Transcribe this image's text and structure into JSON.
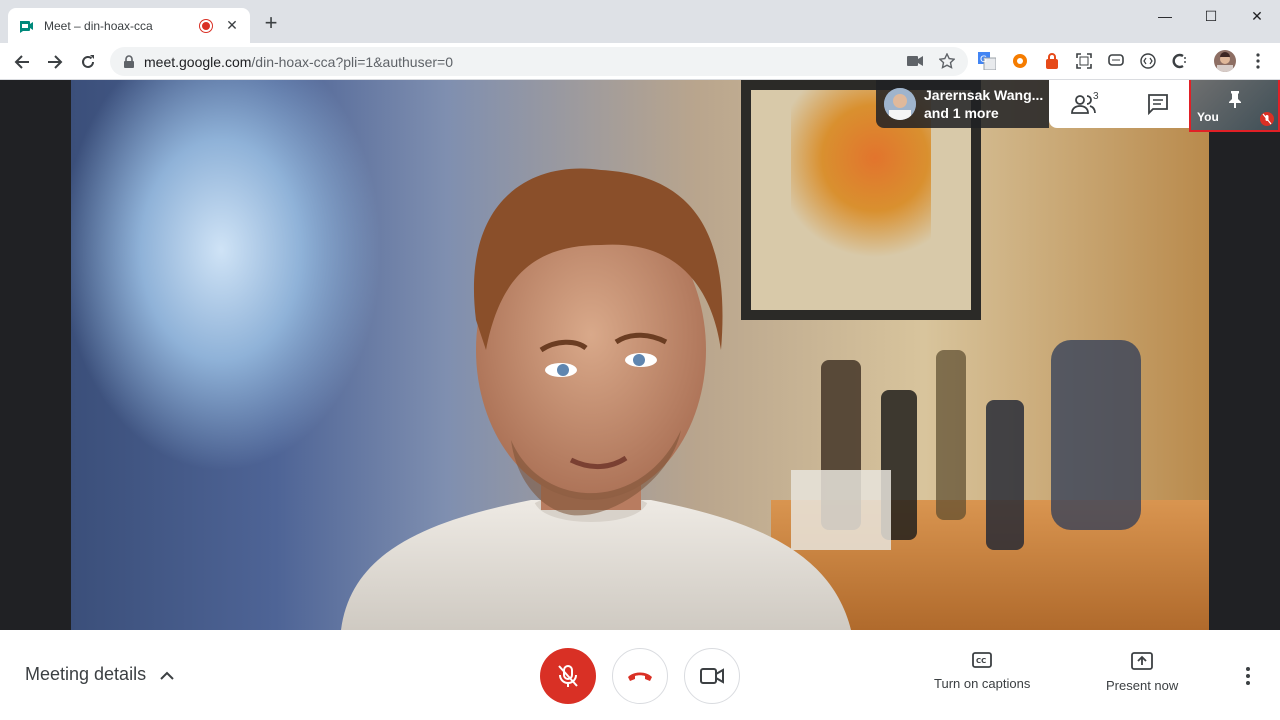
{
  "browser": {
    "tab_title": "Meet – din-hoax-cca",
    "tab_close": "✕",
    "new_tab": "+",
    "url_host": "meet.google.com",
    "url_path": "/din-hoax-cca?pli=1&authuser=0",
    "window_controls": {
      "minimize": "—",
      "maximize": "☐",
      "close": "✕"
    }
  },
  "meet": {
    "participants_chip": {
      "line1": "Jarernsak Wang...",
      "line2": "and 1 more"
    },
    "people_count": "3",
    "self_tile_label": "You",
    "meeting_details": "Meeting details",
    "captions_label": "Turn on captions",
    "present_label": "Present now",
    "colors": {
      "mic_off_red": "#d93025",
      "highlight_border": "#e12026",
      "hangup_red": "#d93025"
    }
  },
  "icons": [
    "meet-favicon",
    "recording-dot",
    "back-arrow",
    "forward-arrow",
    "reload",
    "lock",
    "camera",
    "star",
    "translate",
    "extensions",
    "profile-avatar",
    "kebab-menu",
    "people",
    "chat",
    "pin",
    "mic-off",
    "chevron-up",
    "hangup-phone",
    "video-camera",
    "closed-captions",
    "present-screen"
  ]
}
